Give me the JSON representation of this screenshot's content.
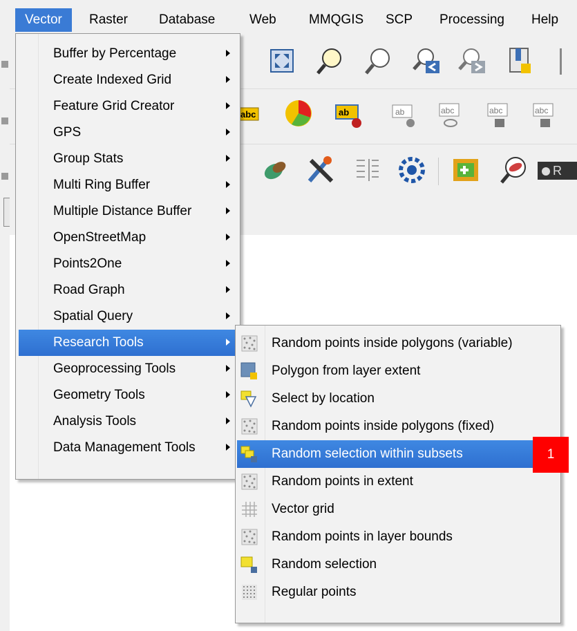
{
  "menubar": {
    "items": [
      "Vector",
      "Raster",
      "Database",
      "Web",
      "MMQGIS",
      "SCP",
      "Processing",
      "Help"
    ],
    "active_index": 0
  },
  "toolbar_icons": {
    "row1": [
      "pan-to-selection-icon",
      "zoom-full-icon",
      "zoom-in-icon",
      "zoom-out-icon",
      "zoom-last-icon",
      "zoom-next-icon",
      "new-bookmark-icon"
    ],
    "row2": [
      "label-abc-icon",
      "diagram-pie-icon",
      "layer-labeling-icon",
      "pin-label-icon",
      "show-hide-labels-icon",
      "move-label-icon",
      "rotate-label-icon"
    ],
    "row3": [
      "coordinate-capture-icon",
      "tools-icon",
      "attribute-table-icon",
      "processing-icon",
      "add-vector-icon",
      "identify-icon"
    ],
    "row3_trailing_text": "R"
  },
  "vector_menu": {
    "items": [
      "Buffer by Percentage",
      "Create Indexed Grid",
      "Feature Grid Creator",
      "GPS",
      "Group Stats",
      "Multi Ring Buffer",
      "Multiple Distance Buffer",
      "OpenStreetMap",
      "Points2One",
      "Road Graph",
      "Spatial Query",
      "Research Tools",
      "Geoprocessing Tools",
      "Geometry Tools",
      "Analysis Tools",
      "Data Management Tools"
    ],
    "highlighted_index": 11
  },
  "research_submenu": {
    "items": [
      {
        "label": "Random points inside polygons (variable)",
        "icon": "random-points-icon"
      },
      {
        "label": "Polygon from layer extent",
        "icon": "polygon-extent-icon"
      },
      {
        "label": "Select by location",
        "icon": "select-location-icon"
      },
      {
        "label": "Random points inside polygons (fixed)",
        "icon": "random-points-icon"
      },
      {
        "label": "Random selection within subsets",
        "icon": "random-selection-subsets-icon"
      },
      {
        "label": "Random points in extent",
        "icon": "random-points-icon"
      },
      {
        "label": "Vector grid",
        "icon": "vector-grid-icon"
      },
      {
        "label": "Random points in layer bounds",
        "icon": "random-points-icon"
      },
      {
        "label": "Random selection",
        "icon": "random-selection-icon"
      },
      {
        "label": "Regular points",
        "icon": "regular-points-icon"
      }
    ],
    "highlighted_index": 4
  },
  "annotation_badge": "1",
  "colors": {
    "highlight": "#3a7bd5",
    "badge": "#ff0000",
    "menu_bg": "#f2f2f2"
  }
}
